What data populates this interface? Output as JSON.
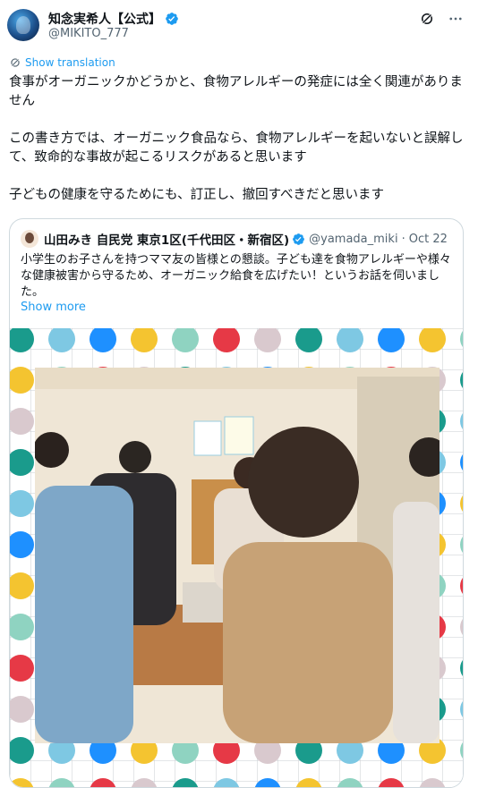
{
  "author": {
    "name": "知念実希人【公式】",
    "handle": "@MIKITO_777"
  },
  "translate_label": "Show translation",
  "tweet_paragraphs": [
    "食事がオーガニックかどうかと、食物アレルギーの発症には全く関連がありません",
    "この書き方では、オーガニック食品なら、食物アレルギーを起いないと誤解して、致命的な事故が起こるリスクがあると思います",
    "子どもの健康を守るためにも、訂正し、撤回すべきだと思います"
  ],
  "quoted": {
    "name": "山田みき 自民党 東京1区(千代田区・新宿区)",
    "handle": "@yamada_miki",
    "date": "Oct 22",
    "separator": "·",
    "text": "小学生のお子さんを持つママ友の皆様との懇談。子ども達を食物アレルギーや様々な健康被害から守るため、オーガニック給食を広げたい！というお話を伺いました。",
    "show_more": "Show more"
  },
  "icons": {
    "verified": "verified-badge-icon",
    "grok": "grok-icon",
    "more": "more-icon",
    "translate": "translate-icon"
  },
  "colors": {
    "link": "#1d9bf0",
    "muted": "#536471",
    "dots": [
      "#1a9b8c",
      "#e63946",
      "#f4c430",
      "#7ec8e3",
      "#d9c9ce",
      "#8fd3c1",
      "#1e90ff"
    ]
  }
}
